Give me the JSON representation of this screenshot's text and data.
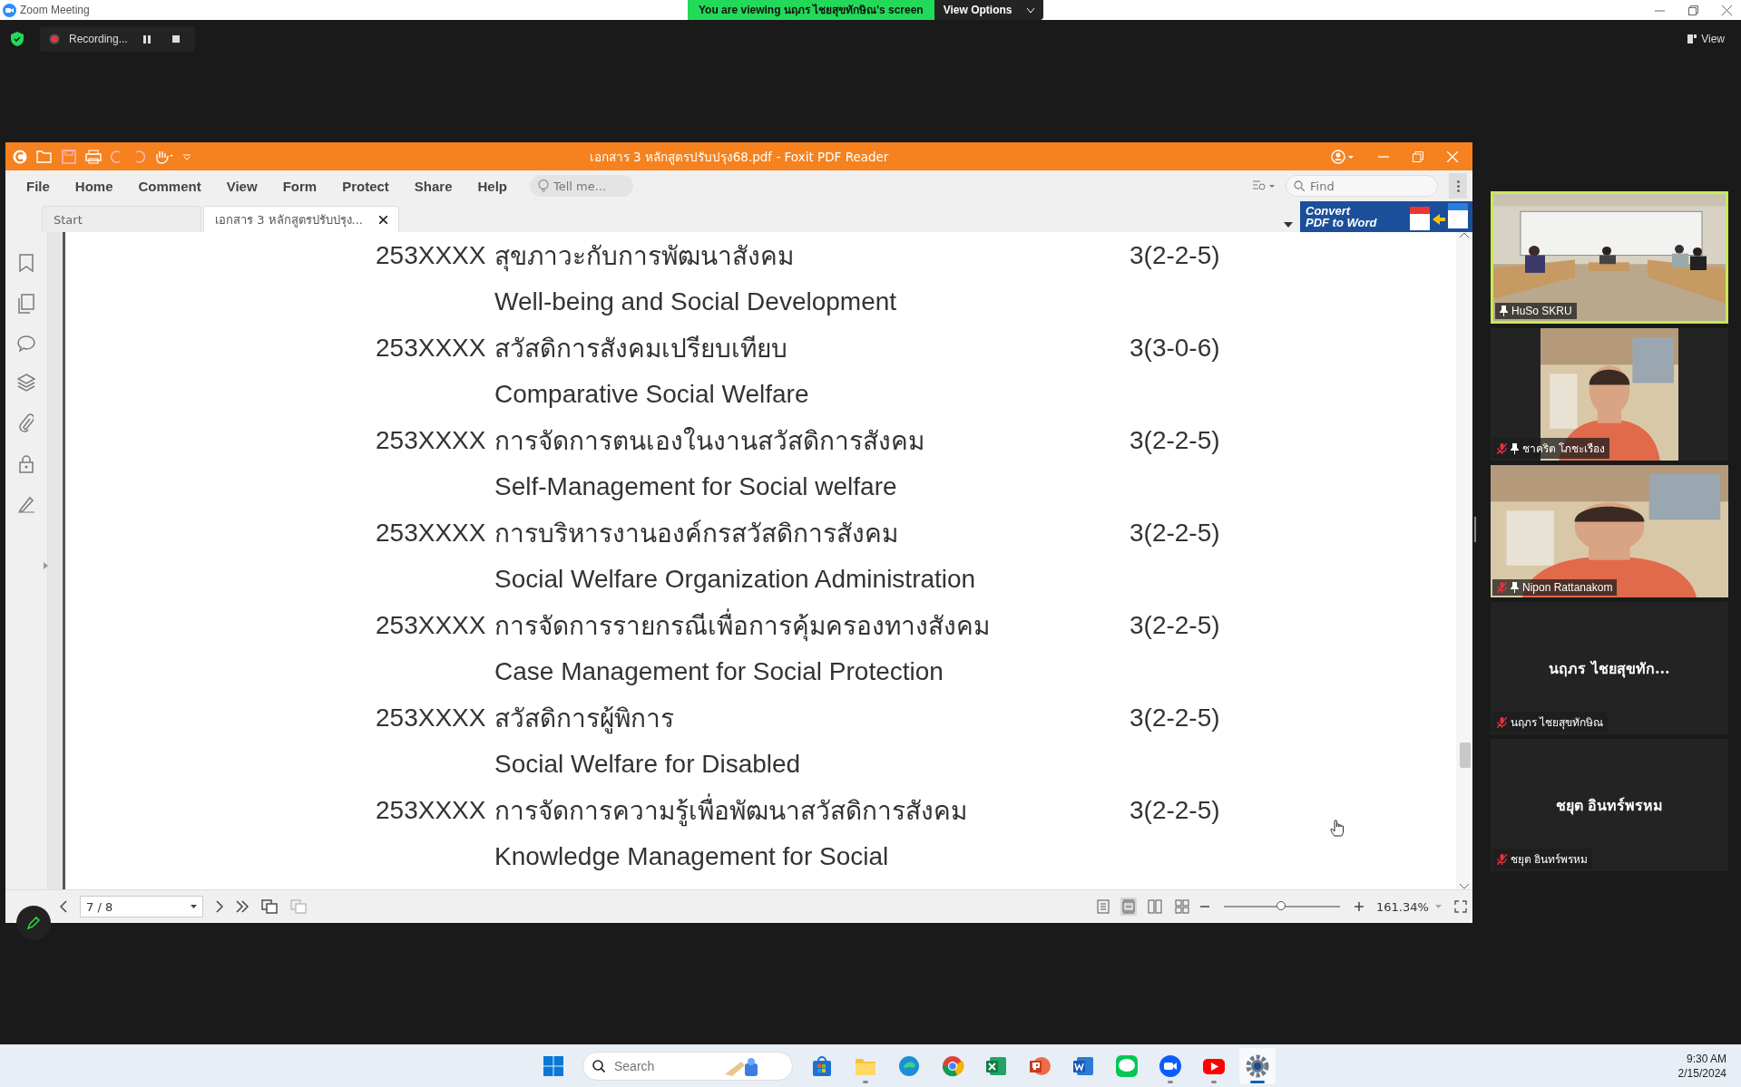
{
  "zoom_window": {
    "title": "Zoom Meeting",
    "share_banner": {
      "text": "You are viewing นฤภร  ไชยสุขทักษิณ's screen",
      "button": "View Options"
    },
    "recording": {
      "label": "Recording...",
      "secure": true
    },
    "view_button": "View"
  },
  "pdf_reader": {
    "title": "เอกสาร 3 หลักสูตรปรับปรุง68.pdf - Foxit PDF Reader",
    "menu": [
      "File",
      "Home",
      "Comment",
      "View",
      "Form",
      "Protect",
      "Share",
      "Help"
    ],
    "tell_me": {
      "placeholder": "Tell me..."
    },
    "find": {
      "placeholder": "Find"
    },
    "tabs": [
      {
        "label": "Start",
        "selected": false,
        "closable": false
      },
      {
        "label": "เอกสาร 3 หลักสูตรปรับปรุง...",
        "selected": true,
        "closable": true
      }
    ],
    "convert_banner": [
      "Convert",
      "PDF to Word"
    ],
    "courses": [
      {
        "code": "253XXXX",
        "thai": "สุขภาวะกับการพัฒนาสังคม",
        "credits": "3(2-2-5)",
        "english": "Well-being and Social Development"
      },
      {
        "code": "253XXXX",
        "thai": "สวัสดิการสังคมเปรียบเทียบ",
        "credits": "3(3-0-6)",
        "english": "Comparative Social Welfare"
      },
      {
        "code": "253XXXX",
        "thai": "การจัดการตนเองในงานสวัสดิการสังคม",
        "credits": "3(2-2-5)",
        "english": "Self-Management for Social welfare"
      },
      {
        "code": "253XXXX",
        "thai": "การบริหารงานองค์กรสวัสดิการสังคม",
        "credits": "3(2-2-5)",
        "english": "Social Welfare Organization Administration"
      },
      {
        "code": "253XXXX",
        "thai": "การจัดการรายกรณีเพื่อการคุ้มครองทางสังคม",
        "credits": "3(2-2-5)",
        "english": "Case Management for Social Protection"
      },
      {
        "code": "253XXXX",
        "thai": "สวัสดิการผู้พิการ",
        "credits": "3(2-2-5)",
        "english": "Social Welfare for Disabled"
      },
      {
        "code": "253XXXX",
        "thai": "การจัดการความรู้เพื่อพัฒนาสวัสดิการสังคม",
        "credits": "3(2-2-5)",
        "english": "Knowledge Management for Social"
      }
    ],
    "page_field": "7 / 8",
    "zoom_value": "161.34%",
    "zoom_slider": {
      "level": 0.49
    }
  },
  "participants": [
    {
      "name": "HuSo SKRU",
      "camera_on": true,
      "muted": false,
      "pinned": true,
      "speaking": true
    },
    {
      "name": "ชาคริต โภชะเรือง",
      "camera_on": true,
      "muted": true,
      "pinned": true,
      "speaking": false
    },
    {
      "name": "Nipon Rattanakom",
      "camera_on": true,
      "muted": true,
      "pinned": true,
      "speaking": false
    },
    {
      "name": "นฤภร  ไชยสุขทักษิณ",
      "camera_on": false,
      "display_name": "นฤภร  ไชยสุขทัก...",
      "muted": true,
      "pinned": false,
      "speaking": false
    },
    {
      "name": "ชยุต อินทร์พรหม",
      "camera_on": false,
      "display_name": "ชยุต อินทร์พรหม",
      "muted": true,
      "pinned": false,
      "speaking": false
    }
  ],
  "taskbar": {
    "search": {
      "placeholder": "Search"
    },
    "apps": [
      {
        "kind": "store",
        "running": false,
        "selected": false
      },
      {
        "kind": "folder",
        "running": true,
        "selected": false
      },
      {
        "kind": "edge",
        "running": false,
        "selected": false
      },
      {
        "kind": "chrome",
        "running": false,
        "selected": false
      },
      {
        "kind": "excel",
        "running": false,
        "selected": false
      },
      {
        "kind": "powerpoint",
        "running": false,
        "selected": false
      },
      {
        "kind": "word",
        "running": false,
        "selected": false
      },
      {
        "kind": "line",
        "running": false,
        "selected": false
      },
      {
        "kind": "zoom",
        "running": true,
        "selected": false
      },
      {
        "kind": "youtube",
        "running": true,
        "selected": false
      },
      {
        "kind": "settings",
        "running": true,
        "selected": true
      }
    ],
    "time": "9:30 AM",
    "date": "2/15/2024"
  }
}
